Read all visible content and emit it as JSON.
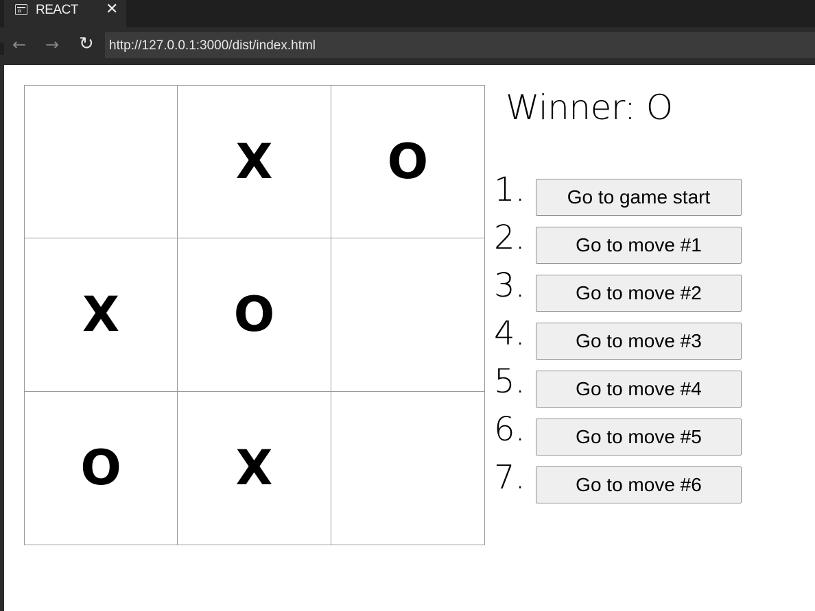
{
  "browser": {
    "tab_title": "REACT",
    "tab_close": "✕",
    "back": "←",
    "forward": "→",
    "reload": "↻",
    "url": "http://127.0.0.1:3000/dist/index.html"
  },
  "game": {
    "squares": [
      "",
      "X",
      "O",
      "X",
      "O",
      "",
      "O",
      "X",
      ""
    ],
    "status": "Winner: O",
    "moves": [
      {
        "num": "1.",
        "label": "Go to game start"
      },
      {
        "num": "2.",
        "label": "Go to move #1"
      },
      {
        "num": "3.",
        "label": "Go to move #2"
      },
      {
        "num": "4.",
        "label": "Go to move #3"
      },
      {
        "num": "5.",
        "label": "Go to move #4"
      },
      {
        "num": "6.",
        "label": "Go to move #5"
      },
      {
        "num": "7.",
        "label": "Go to move #6"
      }
    ]
  }
}
